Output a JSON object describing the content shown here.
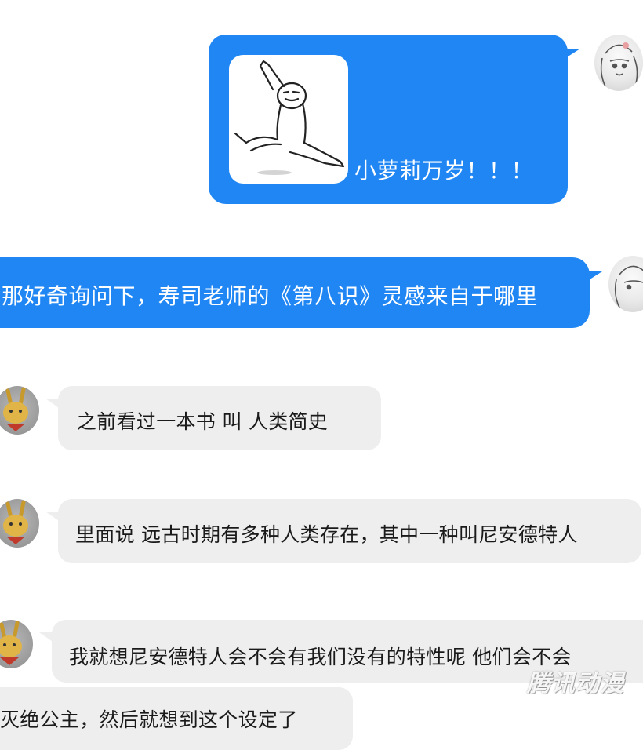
{
  "messages": [
    {
      "id": "m1",
      "sender": "self",
      "sticker": "dancing-stick-figure",
      "text": "小萝莉万岁！！！"
    },
    {
      "id": "m2",
      "sender": "self",
      "text": "那好奇询问下，寿司老师的《第八识》灵感来自于哪里"
    },
    {
      "id": "m3",
      "sender": "other",
      "text": "之前看过一本书  叫 人类简史"
    },
    {
      "id": "m4",
      "sender": "other",
      "text": "里面说 远古时期有多种人类存在，其中一种叫尼安德特人"
    },
    {
      "id": "m5",
      "sender": "other",
      "text": "我就想尼安德特人会不会有我们没有的特性呢  他们会不会"
    },
    {
      "id": "m6",
      "sender": "other",
      "text": "灭绝公主，然后就想到这个设定了"
    }
  ],
  "watermark": "腾讯动漫",
  "colors": {
    "self_bubble": "#1f86f3",
    "other_bubble": "#eeeeee",
    "background": "#ffffff"
  }
}
